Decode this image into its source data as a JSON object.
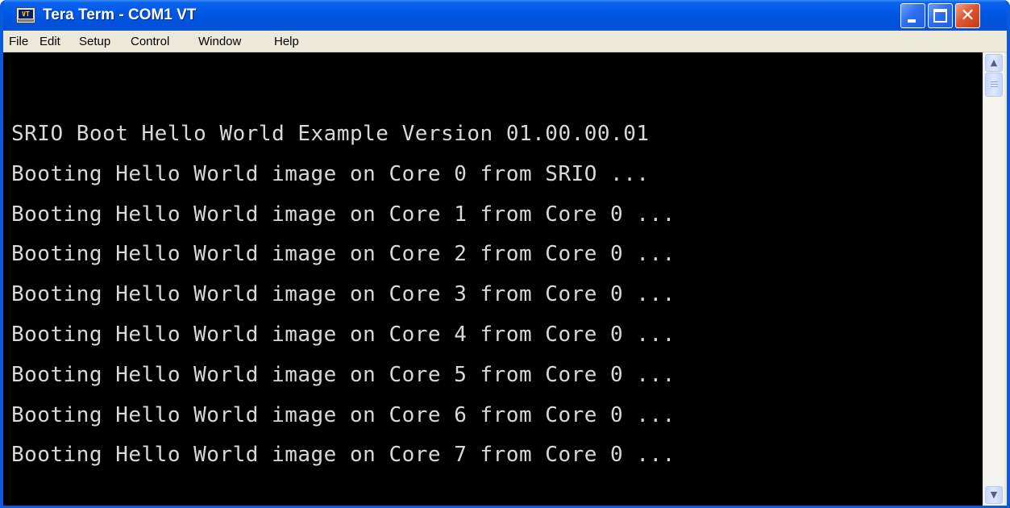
{
  "window": {
    "title": "Tera Term - COM1 VT",
    "icon": "teraterm-vt-icon",
    "icon_text": "VT",
    "buttons": {
      "minimize": "minimize-icon",
      "maximize": "maximize-icon",
      "close": "close-icon",
      "close_glyph": "✕"
    }
  },
  "menu": {
    "items": [
      {
        "label": "File"
      },
      {
        "label": "Edit"
      },
      {
        "label": "Setup"
      },
      {
        "label": "Control"
      },
      {
        "label": "Window"
      },
      {
        "label": "Help"
      }
    ]
  },
  "terminal": {
    "background": "#000000",
    "foreground": "#d8d8d8",
    "lines": [
      "SRIO Boot Hello World Example Version 01.00.00.01",
      "Booting Hello World image on Core 0 from SRIO ...",
      "Booting Hello World image on Core 1 from Core 0 ...",
      "Booting Hello World image on Core 2 from Core 0 ...",
      "Booting Hello World image on Core 3 from Core 0 ...",
      "Booting Hello World image on Core 4 from Core 0 ...",
      "Booting Hello World image on Core 5 from Core 0 ...",
      "Booting Hello World image on Core 6 from Core 0 ...",
      "Booting Hello World image on Core 7 from Core 0 ..."
    ]
  },
  "scrollbar": {
    "up_arrow": "▲",
    "down_arrow": "▼"
  },
  "colors": {
    "titlebar": "#0054e3",
    "menubar": "#ece9d8",
    "close_button": "#e0562e"
  }
}
